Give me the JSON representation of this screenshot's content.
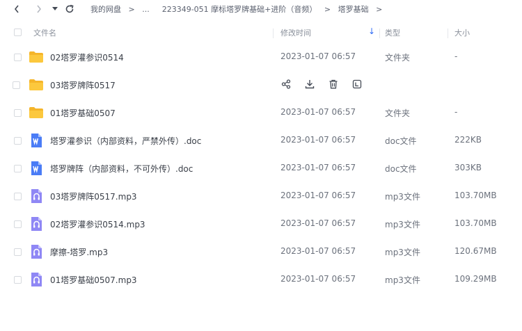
{
  "breadcrumb": {
    "items": [
      "我的网盘",
      "...",
      "223349-051 摩标塔罗牌基础+进阶（音频）",
      "塔罗基础"
    ],
    "separator": ">"
  },
  "header": {
    "name": "文件名",
    "modified": "修改时间",
    "type": "类型",
    "size": "大小",
    "sort_arrow": "↓"
  },
  "files": [
    {
      "name": "02塔罗灌参识0514",
      "time": "2023-01-07 06:57",
      "type": "文件夹",
      "size": "-",
      "icon": "folder-icon"
    },
    {
      "name": "03塔罗牌阵0517",
      "time": "",
      "type": "",
      "size": "",
      "icon": "folder-icon",
      "hovered": true
    },
    {
      "name": "01塔罗基础0507",
      "time": "2023-01-07 06:57",
      "type": "文件夹",
      "size": "-",
      "icon": "folder-icon"
    },
    {
      "name": "塔罗灌参识（内部资料，严禁外传）.doc",
      "time": "2023-01-07 06:57",
      "type": "doc文件",
      "size": "222KB",
      "icon": "word-doc-icon"
    },
    {
      "name": "塔罗牌阵（内部资料，不可外传）.doc",
      "time": "2023-01-07 06:57",
      "type": "doc文件",
      "size": "303KB",
      "icon": "word-doc-icon"
    },
    {
      "name": "03塔罗牌阵0517.mp3",
      "time": "2023-01-07 06:57",
      "type": "mp3文件",
      "size": "103.70MB",
      "icon": "audio-file-icon"
    },
    {
      "name": "02塔罗灌参识0514.mp3",
      "time": "2023-01-07 06:57",
      "type": "mp3文件",
      "size": "103.70MB",
      "icon": "audio-file-icon"
    },
    {
      "name": "摩擦-塔罗.mp3",
      "time": "2023-01-07 06:57",
      "type": "mp3文件",
      "size": "120.67MB",
      "icon": "audio-file-icon"
    },
    {
      "name": "01塔罗基础0507.mp3",
      "time": "2023-01-07 06:57",
      "type": "mp3文件",
      "size": "109.29MB",
      "icon": "audio-file-icon"
    }
  ],
  "row_actions": [
    "share-icon",
    "download-icon",
    "delete-icon",
    "more-icon"
  ],
  "colors": {
    "folder": "#fcc83d",
    "word": "#4a7cf6",
    "audio": "#8f87f5",
    "accent": "#2f6bf5"
  }
}
